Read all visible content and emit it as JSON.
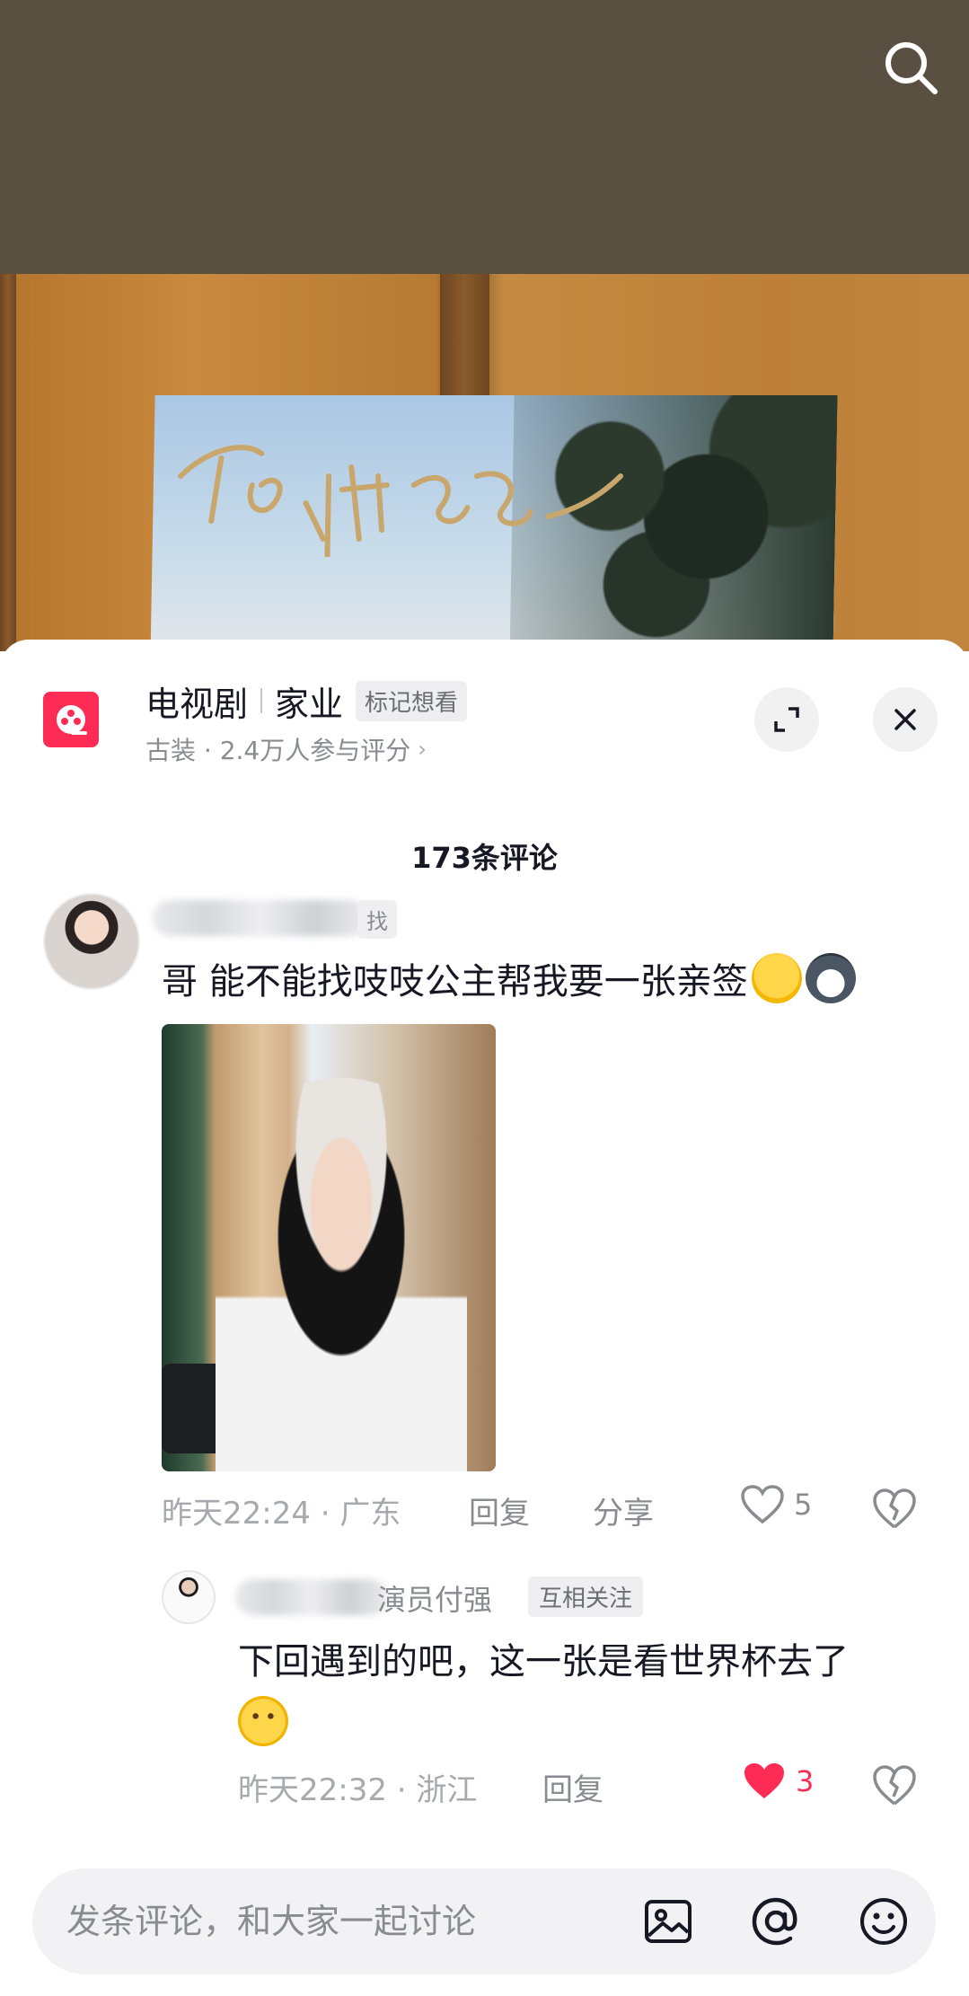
{
  "top": {
    "search_icon": "search-icon",
    "signature_text": "To: 付强"
  },
  "header": {
    "category": "电视剧",
    "title": "家业",
    "mark_label": "标记想看",
    "subtitle": "古装 · 2.4万人参与评分",
    "subtitle_chevron": "›"
  },
  "comments_count_label": "173条评论",
  "comment1": {
    "tag": "找",
    "text": "哥 能不能找吱吱公主帮我要一张亲签",
    "time_location": "昨天22:24 · 广东",
    "reply_label": "回复",
    "share_label": "分享",
    "like_count": "5",
    "liked": false
  },
  "reply1": {
    "name_suffix": "演员付强",
    "relation_badge": "互相关注",
    "text": "下回遇到的吧，这一张是看世界杯去了",
    "time_location": "昨天22:32 · 浙江",
    "reply_label": "回复",
    "like_count": "3",
    "liked": true
  },
  "input": {
    "placeholder": "发条评论，和大家一起讨论"
  },
  "colors": {
    "accent": "#fe2c55",
    "secondary_text": "#8a8b91",
    "badge_bg": "#efeff1"
  }
}
